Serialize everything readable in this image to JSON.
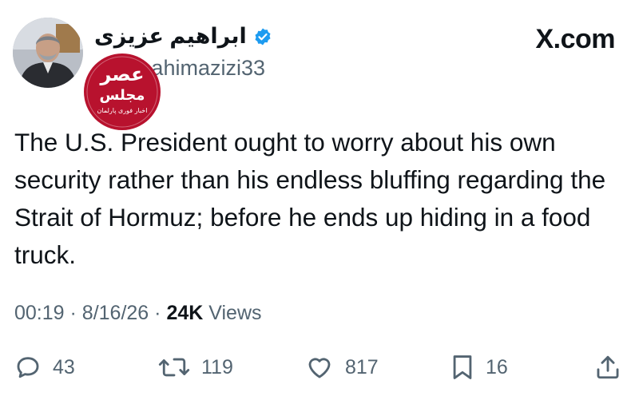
{
  "author": {
    "display_name": "ابراهیم عزیزی",
    "handle_prefix": "@",
    "handle_visible": "ahimazizi33",
    "verified": true
  },
  "site_label": "X.com",
  "watermark": {
    "line1": "عصر",
    "line2": "مجلس",
    "line3": "اخبار فوری پارلمان"
  },
  "tweet": {
    "text": "The U.S. President ought to worry about his own security rather than his endless bluffing regarding the Strait of Hormuz; before he ends up hiding in a food truck."
  },
  "meta": {
    "time": "00:19",
    "date": "8/16/26",
    "views_count": "24K",
    "views_label": "Views",
    "separator": "·"
  },
  "actions": {
    "replies": "43",
    "reposts": "119",
    "likes": "817",
    "bookmarks": "16"
  },
  "colors": {
    "text": "#0f1419",
    "secondary": "#536471",
    "verified": "#1d9bf0",
    "watermark": "#b8122e"
  }
}
